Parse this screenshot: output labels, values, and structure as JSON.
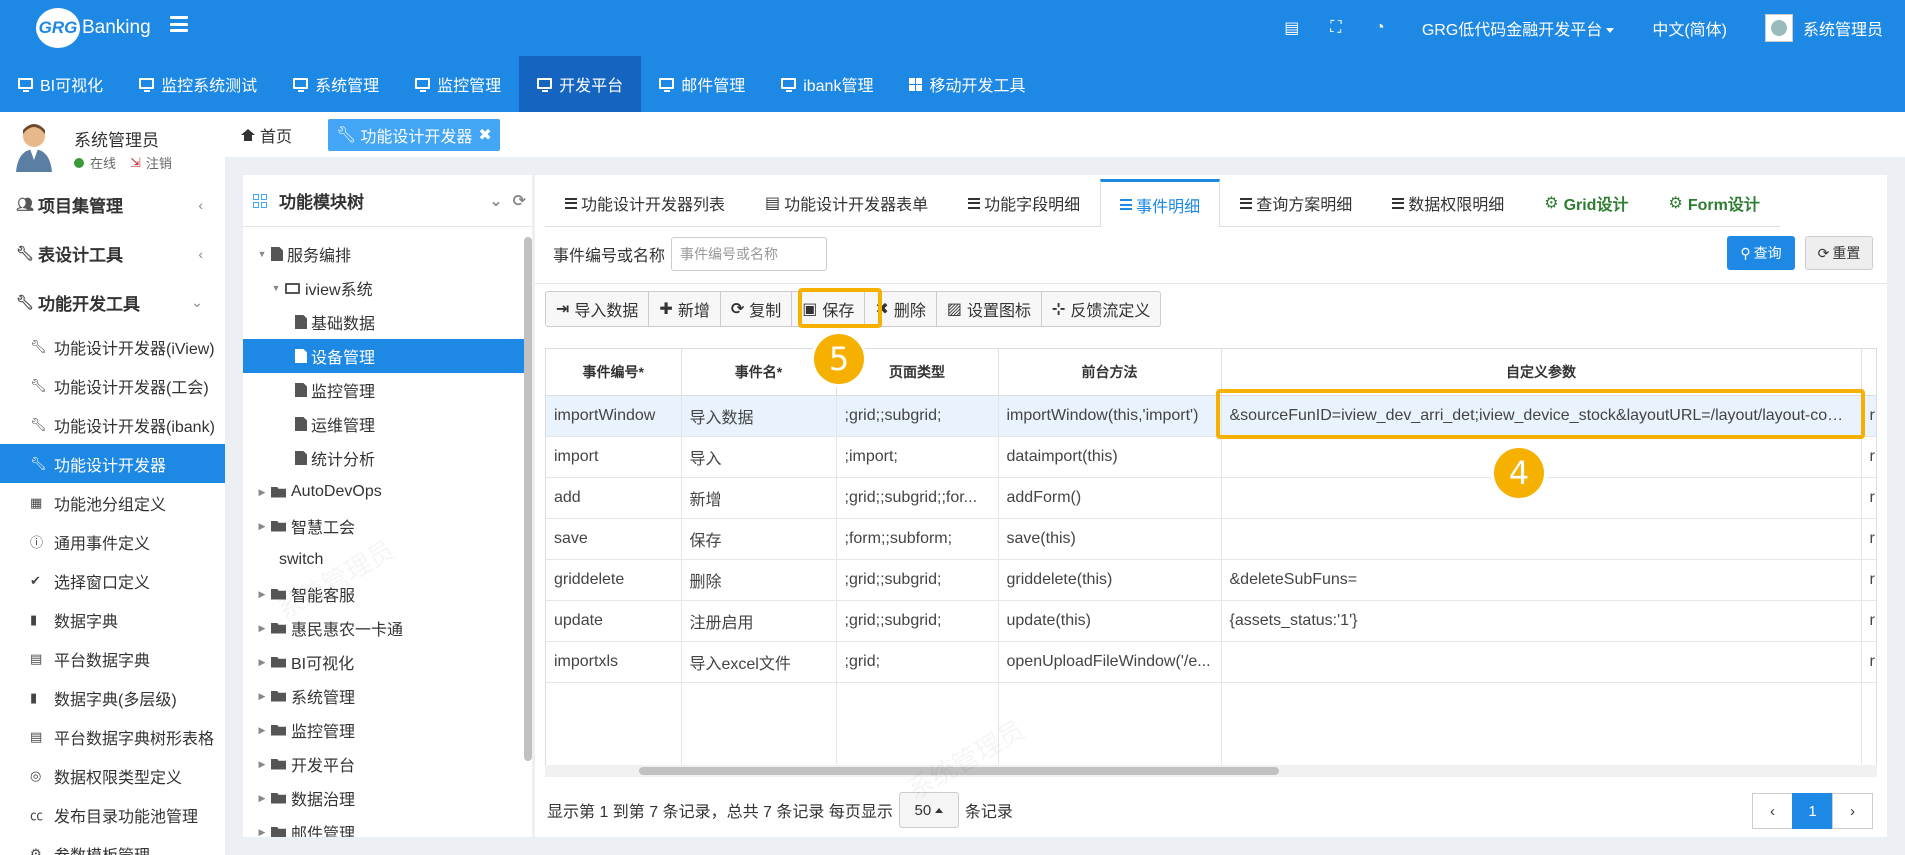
{
  "header": {
    "logo_badge": "GRG",
    "logo_text": "Banking",
    "platform": "GRG低代码金融开发平台",
    "language": "中文(简体)",
    "user": "系统管理员"
  },
  "nav": {
    "items": [
      {
        "label": "BI可视化",
        "icon": "monitor-icon"
      },
      {
        "label": "监控系统测试",
        "icon": "monitor-icon"
      },
      {
        "label": "系统管理",
        "icon": "monitor-icon"
      },
      {
        "label": "监控管理",
        "icon": "monitor-icon"
      },
      {
        "label": "开发平台",
        "icon": "monitor-icon",
        "active": true
      },
      {
        "label": "邮件管理",
        "icon": "monitor-icon"
      },
      {
        "label": "ibank管理",
        "icon": "monitor-icon"
      },
      {
        "label": "移动开发工具",
        "icon": "windows-icon"
      }
    ]
  },
  "sidebar": {
    "user": {
      "name": "系统管理员",
      "online": "在线",
      "logout": "注销"
    },
    "groups": [
      {
        "label": "项目集管理",
        "icon": "users-icon"
      },
      {
        "label": "表设计工具",
        "icon": "wrench-icon"
      },
      {
        "label": "功能开发工具",
        "icon": "wrench-icon"
      }
    ],
    "items": [
      {
        "label": "功能设计开发器(iView)",
        "icon": "wrench-icon"
      },
      {
        "label": "功能设计开发器(工会)",
        "icon": "wrench-icon"
      },
      {
        "label": "功能设计开发器(ibank)",
        "icon": "wrench-icon"
      },
      {
        "label": "功能设计开发器",
        "icon": "wrench-icon",
        "active": true
      },
      {
        "label": "功能池分组定义",
        "icon": "grid-icon"
      },
      {
        "label": "通用事件定义",
        "icon": "info-icon"
      },
      {
        "label": "选择窗口定义",
        "icon": "check-circle-icon"
      },
      {
        "label": "数据字典",
        "icon": "book-icon"
      },
      {
        "label": "平台数据字典",
        "icon": "list-icon"
      },
      {
        "label": "数据字典(多层级)",
        "icon": "book-icon"
      },
      {
        "label": "平台数据字典树形表格",
        "icon": "list-icon"
      },
      {
        "label": "数据权限类型定义",
        "icon": "target-icon"
      },
      {
        "label": "发布目录功能池管理",
        "icon": "cc-icon"
      },
      {
        "label": "参数模板管理",
        "icon": "gear-icon"
      }
    ]
  },
  "tabbar": {
    "home": "首页",
    "current": "功能设计开发器"
  },
  "tree": {
    "title": "功能模块树",
    "nodes": [
      {
        "label": "服务编排",
        "level": 1,
        "type": "file",
        "toggle": "▼"
      },
      {
        "label": "iview系统",
        "level": 2,
        "type": "folder-open",
        "toggle": "▼"
      },
      {
        "label": "基础数据",
        "level": 3,
        "type": "file",
        "toggle": ""
      },
      {
        "label": "设备管理",
        "level": 3,
        "type": "file",
        "toggle": "",
        "selected": true
      },
      {
        "label": "监控管理",
        "level": 3,
        "type": "file",
        "toggle": ""
      },
      {
        "label": "运维管理",
        "level": 3,
        "type": "file",
        "toggle": ""
      },
      {
        "label": "统计分析",
        "level": 3,
        "type": "file",
        "toggle": ""
      },
      {
        "label": "AutoDevOps",
        "level": 1,
        "type": "folder",
        "toggle": "▶"
      },
      {
        "label": "智慧工会",
        "level": 1,
        "type": "folder",
        "toggle": "▶"
      },
      {
        "label": "switch",
        "level": 1,
        "type": "none",
        "toggle": ""
      },
      {
        "label": "智能客服",
        "level": 1,
        "type": "folder",
        "toggle": "▶"
      },
      {
        "label": "惠民惠农一卡通",
        "level": 1,
        "type": "folder",
        "toggle": "▶"
      },
      {
        "label": "BI可视化",
        "level": 1,
        "type": "folder",
        "toggle": "▶"
      },
      {
        "label": "系统管理",
        "level": 1,
        "type": "folder",
        "toggle": "▶"
      },
      {
        "label": "监控管理",
        "level": 1,
        "type": "folder",
        "toggle": "▶"
      },
      {
        "label": "开发平台",
        "level": 1,
        "type": "folder",
        "toggle": "▶"
      },
      {
        "label": "数据治理",
        "level": 1,
        "type": "folder",
        "toggle": "▶"
      },
      {
        "label": "邮件管理",
        "level": 1,
        "type": "folder",
        "toggle": "▶"
      }
    ]
  },
  "main": {
    "tabs": [
      {
        "label": "功能设计开发器列表",
        "icon": "list-icon"
      },
      {
        "label": "功能设计开发器表单",
        "icon": "form-icon"
      },
      {
        "label": "功能字段明细",
        "icon": "list-icon"
      },
      {
        "label": "事件明细",
        "icon": "list-icon",
        "active": true
      },
      {
        "label": "查询方案明细",
        "icon": "list-icon"
      },
      {
        "label": "数据权限明细",
        "icon": "list-icon"
      },
      {
        "label": "Grid设计",
        "icon": "gear-icon",
        "green": true
      },
      {
        "label": "Form设计",
        "icon": "gear-icon",
        "green": true
      }
    ],
    "filter": {
      "label": "事件编号或名称",
      "placeholder": "事件编号或名称"
    },
    "query_btn": "查询",
    "reset_btn": "重置",
    "toolbar": [
      {
        "label": "导入数据",
        "glyph": "⇥"
      },
      {
        "label": "新增",
        "glyph": "✚"
      },
      {
        "label": "复制",
        "glyph": "⟳"
      },
      {
        "label": "保存",
        "glyph": "▣"
      },
      {
        "label": "删除",
        "glyph": "✖"
      },
      {
        "label": "设置图标",
        "glyph": "▨"
      },
      {
        "label": "反馈流定义",
        "glyph": "⊹"
      }
    ],
    "table": {
      "columns": [
        "事件编号*",
        "事件名*",
        "页面类型",
        "前台方法",
        "自定义参数"
      ],
      "rows": [
        [
          "importWindow",
          "导入数据",
          ";grid;;subgrid;",
          "importWindow(this,'import')",
          "&sourceFunID=iview_dev_arri_det;iview_device_stock&layoutURL=/layout/layout-com...",
          "r"
        ],
        [
          "import",
          "导入",
          ";import;",
          "dataimport(this)",
          "",
          "r"
        ],
        [
          "add",
          "新增",
          ";grid;;subgrid;;for...",
          "addForm()",
          "",
          "r"
        ],
        [
          "save",
          "保存",
          ";form;;subform;",
          "save(this)",
          "",
          "r"
        ],
        [
          "griddelete",
          "删除",
          ";grid;;subgrid;",
          "griddelete(this)",
          "&deleteSubFuns=",
          "r"
        ],
        [
          "update",
          "注册启用",
          ";grid;;subgrid;",
          "update(this)",
          "{assets_status:'1'}",
          "r"
        ],
        [
          "importxls",
          "导入excel文件",
          ";grid;",
          "openUploadFileWindow('/e...",
          "",
          "r"
        ]
      ]
    },
    "footer": {
      "info": "显示第 1 到第 7 条记录，总共 7 条记录 每页显示",
      "page_size": "50",
      "suffix": "条记录"
    },
    "pager": {
      "prev": "‹",
      "current": "1",
      "next": "›"
    }
  },
  "annotations": {
    "badge4": "4",
    "badge5": "5"
  },
  "watermark": "系统管理员"
}
